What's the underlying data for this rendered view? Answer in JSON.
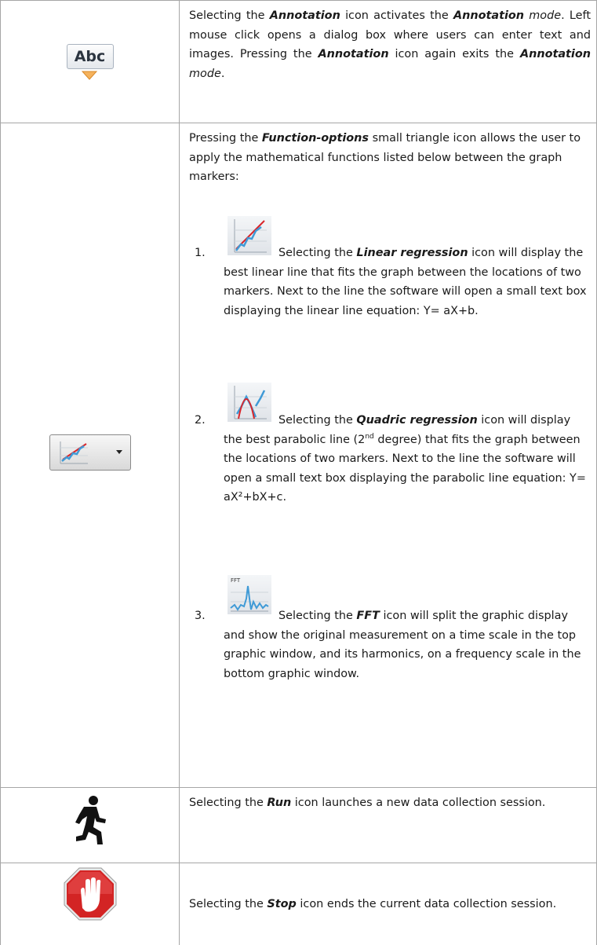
{
  "rows": [
    {
      "icon": "annotation-abc-icon",
      "icon_label": "Abc",
      "pre": "Selecting the ",
      "b1": "Annotation",
      "mid1": " icon activates the ",
      "b2": "Annotation",
      "i1": "mode",
      "mid2": ". Left mouse click opens a dialog box where users can enter text and images. Pressing the ",
      "b3": "Annotation",
      "mid3": " icon again exits the ",
      "b4": "Annotation",
      "i2": "mode",
      "end": "."
    },
    {
      "icon": "function-options-icon",
      "intro_pre": "Pressing the ",
      "intro_b": "Function-options",
      "intro_post": " small triangle icon allows the user to apply the mathematical functions listed below between the graph markers:",
      "items": [
        {
          "num": "1.",
          "icon": "linear-regression-icon",
          "pre": "Selecting the ",
          "b": "Linear regression",
          "post": " icon will display the best linear line that fits the graph between the locations of two markers. Next to the line the software will open a small text box displaying the linear line equation: Y= aX+b."
        },
        {
          "num": "2.",
          "icon": "quadric-regression-icon",
          "pre": "Selecting the ",
          "b": "Quadric regression",
          "post1": " icon will display the best parabolic line (2",
          "sup": "nd",
          "post2": " degree) that fits the graph between the locations of two markers. Next to the line the software will open a small text box displaying the parabolic line equation: Y= aX²+bX+c."
        },
        {
          "num": "3.",
          "icon": "fft-icon",
          "icon_label": "FFT",
          "pre": "Selecting the ",
          "b": "FFT",
          "post": " icon will split the graphic display and show the original measurement on a time scale in the top graphic window, and its harmonics, on a frequency scale in the bottom graphic window."
        }
      ]
    },
    {
      "icon": "run-icon",
      "pre": "Selecting the ",
      "b": "Run",
      "post": " icon launches a new data collection session."
    },
    {
      "icon": "stop-icon",
      "pre": "Selecting the ",
      "b": "Stop",
      "post": " icon ends the current data collection session."
    }
  ]
}
